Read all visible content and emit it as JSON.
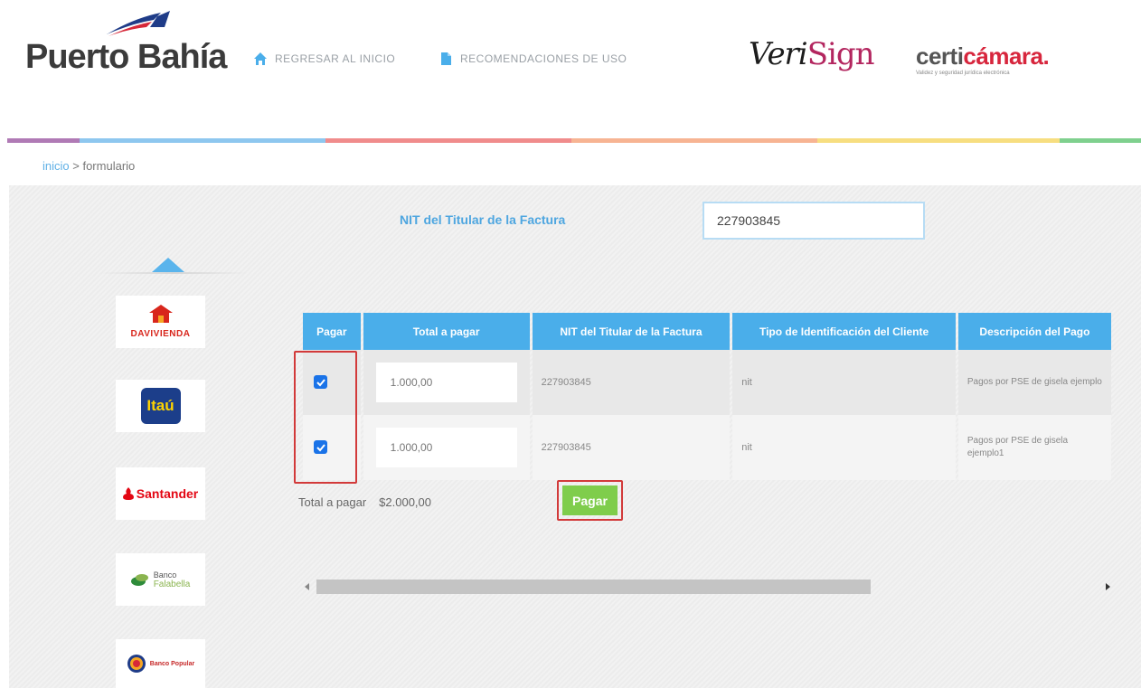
{
  "header": {
    "brand": "Puerto Bahía",
    "nav": [
      {
        "label": "REGRESAR AL INICIO",
        "icon": "home-icon"
      },
      {
        "label": "RECOMENDACIONES DE USO",
        "icon": "document-icon"
      }
    ],
    "partner_logos": {
      "verisign_a": "V",
      "verisign_b": "eri",
      "verisign_c": "Sign",
      "certicamara_a": "certi",
      "certicamara_b": "cámara.",
      "certicamara_tagline": "Validez y seguridad jurídica electrónica"
    }
  },
  "colors": {
    "accent": "#4aaeea",
    "pay_button": "#7fcd4c",
    "highlight": "#d23a3a",
    "bar": [
      "#b07ab5",
      "#8ec7ef",
      "#f08c8c",
      "#f7b493",
      "#f7de80",
      "#7fd08e"
    ]
  },
  "breadcrumb": {
    "home": "inicio",
    "separator": ">",
    "current": "formulario"
  },
  "form": {
    "nit_label": "NIT del Titular de la Factura",
    "nit_value": "227903845"
  },
  "banks": [
    {
      "name": "DAVIVIENDA",
      "icon": "davivienda-house-icon"
    },
    {
      "name": "Itaú",
      "icon": "itau-logo"
    },
    {
      "name": "Santander",
      "icon": "santander-flame-icon"
    },
    {
      "name_a": "Banco",
      "name_b": "Falabella",
      "icon": "falabella-leaf-icon"
    },
    {
      "name": "Banco Popular",
      "icon": "popular-logo"
    }
  ],
  "table": {
    "headers": [
      "Pagar",
      "Total a pagar",
      "NIT del Titular de la Factura",
      "Tipo de Identificación del Cliente",
      "Descripción del Pago"
    ],
    "rows": [
      {
        "checked": true,
        "total": "1.000,00",
        "nit": "227903845",
        "tipo": "nit",
        "descripcion": "Pagos por PSE de gisela ejemplo"
      },
      {
        "checked": true,
        "total": "1.000,00",
        "nit": "227903845",
        "tipo": "nit",
        "descripcion": "Pagos por PSE de gisela ejemplo1"
      }
    ]
  },
  "summary": {
    "total_label": "Total a pagar",
    "total_value": "$2.000,00",
    "pay_button": "Pagar"
  }
}
